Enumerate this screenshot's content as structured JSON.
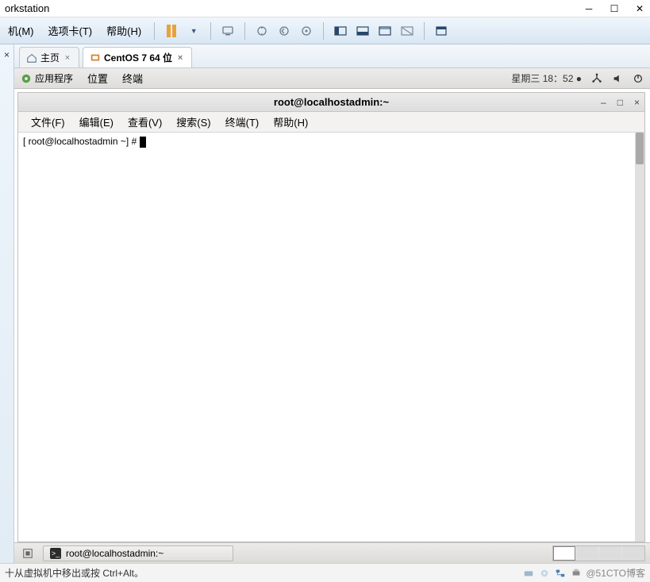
{
  "window": {
    "title_fragment": "orkstation",
    "minimize": "─",
    "maximize": "☐",
    "close": "✕"
  },
  "menubar": {
    "vm": "机(M)",
    "tabs": "选项卡(T)",
    "help": "帮助(H)"
  },
  "sidebar": {
    "collapse": "×"
  },
  "vm_tabs": [
    {
      "icon": "home-icon",
      "label": "主页",
      "active": false
    },
    {
      "icon": "vm-icon",
      "label": "CentOS 7 64 位",
      "active": true
    }
  ],
  "gnome": {
    "applications": "应用程序",
    "places": "位置",
    "terminal": "终端",
    "datetime": "星期三 18：52",
    "menu_file": "文件(F)",
    "menu_edit": "编辑(E)",
    "menu_view": "查看(V)",
    "menu_search": "搜索(S)",
    "menu_terminal": "终端(T)",
    "menu_help": "帮助(H)"
  },
  "terminal": {
    "title": "root@localhostadmin:~",
    "prompt": "[ root@localhostadmin ~] # ",
    "taskbar_label": "root@localhostadmin:~"
  },
  "statusbar": {
    "hint": "十从虚拟机中移出或按 Ctrl+Alt。",
    "watermark": "@51CTO博客"
  }
}
